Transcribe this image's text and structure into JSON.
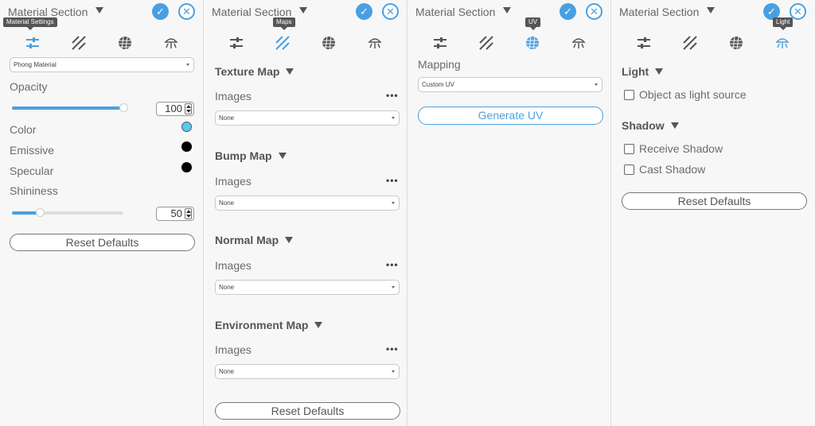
{
  "panels": [
    {
      "title": "Material Section",
      "active_tab": 0,
      "tooltip": "Material Settings"
    },
    {
      "title": "Material Section",
      "active_tab": 1,
      "tooltip": "Maps"
    },
    {
      "title": "Material Section",
      "active_tab": 2,
      "tooltip": "UV"
    },
    {
      "title": "Material Section",
      "active_tab": 3,
      "tooltip": "Light"
    }
  ],
  "icons": [
    "settings-sliders-icon",
    "maps-hatch-icon",
    "uv-sphere-icon",
    "light-lamp-icon"
  ],
  "colors": {
    "accent": "#4a9fe0",
    "inactive_icon": "#555555",
    "color_swatch": "#5bc8ef",
    "emissive_swatch": "#000000",
    "specular_swatch": "#000000"
  },
  "settings": {
    "material_type": "Phong Material",
    "opacity_label": "Opacity",
    "opacity_value": "100",
    "opacity_fraction": 1.0,
    "color_label": "Color",
    "emissive_label": "Emissive",
    "specular_label": "Specular",
    "shininess_label": "Shininess",
    "shininess_value": "50",
    "shininess_fraction": 0.25,
    "reset_label": "Reset Defaults"
  },
  "maps": {
    "sections": [
      {
        "title": "Texture Map",
        "images_label": "Images",
        "selected": "None"
      },
      {
        "title": "Bump Map",
        "images_label": "Images",
        "selected": "None"
      },
      {
        "title": "Normal Map",
        "images_label": "Images",
        "selected": "None"
      },
      {
        "title": "Environment Map",
        "images_label": "Images",
        "selected": "None"
      }
    ],
    "more_label": "•••",
    "reset_label": "Reset Defaults"
  },
  "uv": {
    "mapping_label": "Mapping",
    "mapping_value": "Custom UV",
    "generate_label": "Generate UV"
  },
  "light": {
    "light_title": "Light",
    "object_light_source": "Object as light source",
    "shadow_title": "Shadow",
    "receive_shadow": "Receive Shadow",
    "cast_shadow": "Cast Shadow",
    "reset_label": "Reset Defaults"
  }
}
